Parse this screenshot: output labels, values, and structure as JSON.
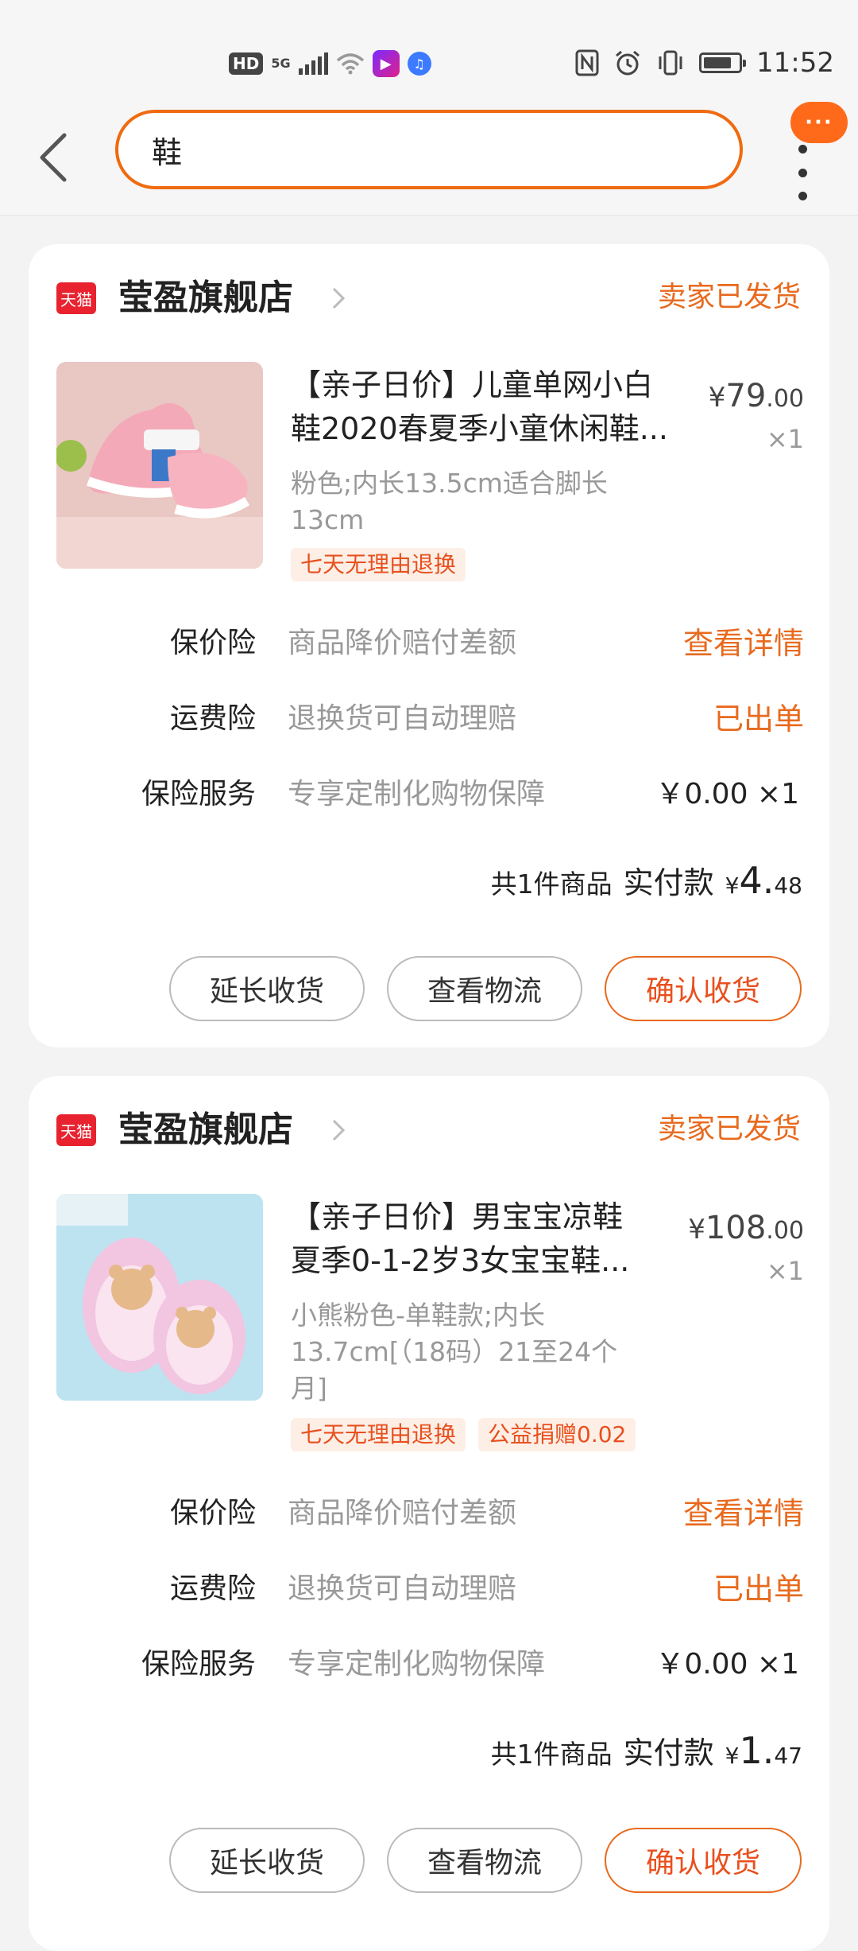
{
  "status_bar": {
    "hd": "HD",
    "network": "5G",
    "time": "11:52",
    "battery_level": 0.7
  },
  "header": {
    "search_value": "鞋",
    "bubble": "···"
  },
  "colors": {
    "accent": "#e86a1e",
    "search_border": "#f06a10",
    "tmall_red": "#e8232f"
  },
  "orders": [
    {
      "store_badge": "天猫",
      "store_name": "莹盈旗舰店",
      "status": "卖家已发货",
      "title_line1": "【亲子日价】儿童单网小白",
      "title_line2": "鞋2020春夏季小童休闲鞋...",
      "price_symbol": "¥",
      "price_int": "79",
      "price_dec": ".00",
      "qty": "×1",
      "sku": "粉色;内长13.5cm适合脚长13cm",
      "tags": [
        "七天无理由退换"
      ],
      "services": [
        {
          "label": "保价险",
          "desc": "商品降价赔付差额",
          "action": "查看详情"
        },
        {
          "label": "运费险",
          "desc": "退换货可自动理赔",
          "action": "已出单"
        },
        {
          "label": "保险服务",
          "desc": "专享定制化购物保障",
          "value": "￥0.00 ×1"
        }
      ],
      "total_count": "共1件商品",
      "total_label": "实付款",
      "total_symbol": "¥",
      "total_int": "4.",
      "total_dec": "48",
      "buttons": [
        "延长收货",
        "查看物流",
        "确认收货"
      ]
    },
    {
      "store_badge": "天猫",
      "store_name": "莹盈旗舰店",
      "status": "卖家已发货",
      "title_line1": "【亲子日价】男宝宝凉鞋",
      "title_line2": "夏季0-1-2岁3女宝宝鞋...",
      "price_symbol": "¥",
      "price_int": "108",
      "price_dec": ".00",
      "qty": "×1",
      "sku": "小熊粉色-单鞋款;内长13.7cm[（18码）21至24个月]",
      "tags": [
        "七天无理由退换",
        "公益捐赠0.02"
      ],
      "services": [
        {
          "label": "保价险",
          "desc": "商品降价赔付差额",
          "action": "查看详情"
        },
        {
          "label": "运费险",
          "desc": "退换货可自动理赔",
          "action": "已出单"
        },
        {
          "label": "保险服务",
          "desc": "专享定制化购物保障",
          "value": "￥0.00 ×1"
        }
      ],
      "total_count": "共1件商品",
      "total_label": "实付款",
      "total_symbol": "¥",
      "total_int": "1.",
      "total_dec": "47",
      "buttons": [
        "延长收货",
        "查看物流",
        "确认收货"
      ]
    }
  ]
}
